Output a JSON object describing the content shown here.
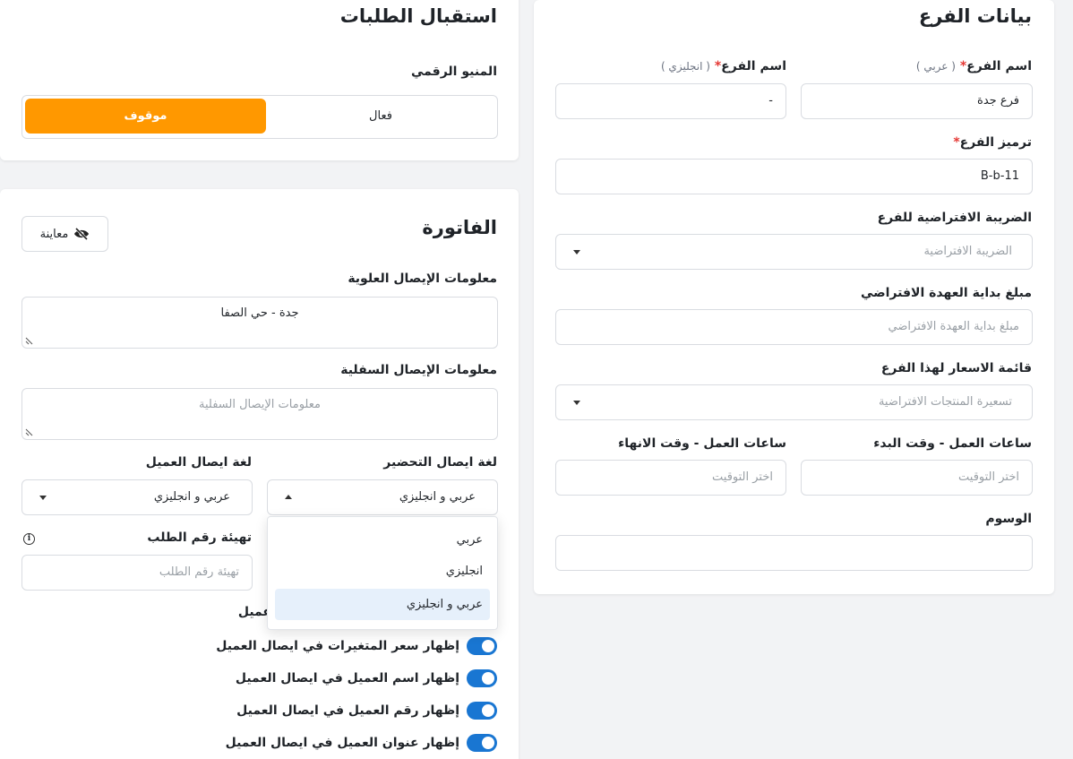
{
  "branch": {
    "title": "بيانات الفرع",
    "name_ar": {
      "label": "اسم الفرع",
      "required": "*",
      "hint": "( عربي )",
      "value": "فرع جدة"
    },
    "name_en": {
      "label": "اسم الفرع",
      "required": "*",
      "hint": "( انجليزي )",
      "value": "-"
    },
    "code": {
      "label": "ترميز الفرع",
      "required": "*",
      "value": "B-b-11"
    },
    "tax": {
      "label": "الضريبة الافتراضية للفرع",
      "placeholder": "الضريبة الافتراضية"
    },
    "custody": {
      "label": "مبلغ بداية العهدة الافتراضي",
      "placeholder": "مبلغ بداية العهدة الافتراضي"
    },
    "pricelist": {
      "label": "قائمة الاسعار لهذا الفرع",
      "placeholder": "تسعيرة المنتجات الافتراضية"
    },
    "work_start": {
      "label": "ساعات العمل - وقت البدء",
      "placeholder": "اختر التوقيت"
    },
    "work_end": {
      "label": "ساعات العمل - وقت الانهاء",
      "placeholder": "اختر التوقيت"
    },
    "tags": {
      "label": "الوسوم",
      "value": ""
    }
  },
  "orders": {
    "title": "استقبال الطلبات",
    "digital_menu": {
      "label": "المنيو الرقمي",
      "option_active": "فعال",
      "option_stopped": "موقوف",
      "selected": "موقوف"
    }
  },
  "invoice": {
    "title": "الفاتورة",
    "preview_label": "معاينة",
    "header_info": {
      "label": "معلومات الإيصال العلوية",
      "value": "جدة - حي الصفا"
    },
    "footer_info": {
      "label": "معلومات الإيصال السفلية",
      "placeholder": "معلومات الإيصال السفلية"
    },
    "prep_lang": {
      "label": "لغة ايصال التحضير",
      "value": "عربي و انجليزي"
    },
    "customer_lang": {
      "label": "لغة ايصال العميل",
      "value": "عربي و انجليزي"
    },
    "order_number": {
      "label": "تهيئة رقم الطلب",
      "placeholder": "تهيئة رقم الطلب",
      "info": "i"
    },
    "partial_label": "عميل",
    "dropdown_options": [
      "عربي",
      "انجليزي",
      "عربي و انجليزي"
    ],
    "dropdown_selected_index": 2,
    "toggles": [
      {
        "label": "إظهار سعر المتغيرات في ايصال العميل",
        "on": true
      },
      {
        "label": "إظهار اسم العميل في ايصال العميل",
        "on": true
      },
      {
        "label": "إظهار رقم العميل في ايصال العميل",
        "on": true
      },
      {
        "label": "إظهار عنوان العميل في ايصال العميل",
        "on": true
      }
    ]
  },
  "colors": {
    "accent": "#ff9800",
    "toggle": "#1976d2",
    "selected_option": "#e6f0fb",
    "required": "#e53935"
  }
}
